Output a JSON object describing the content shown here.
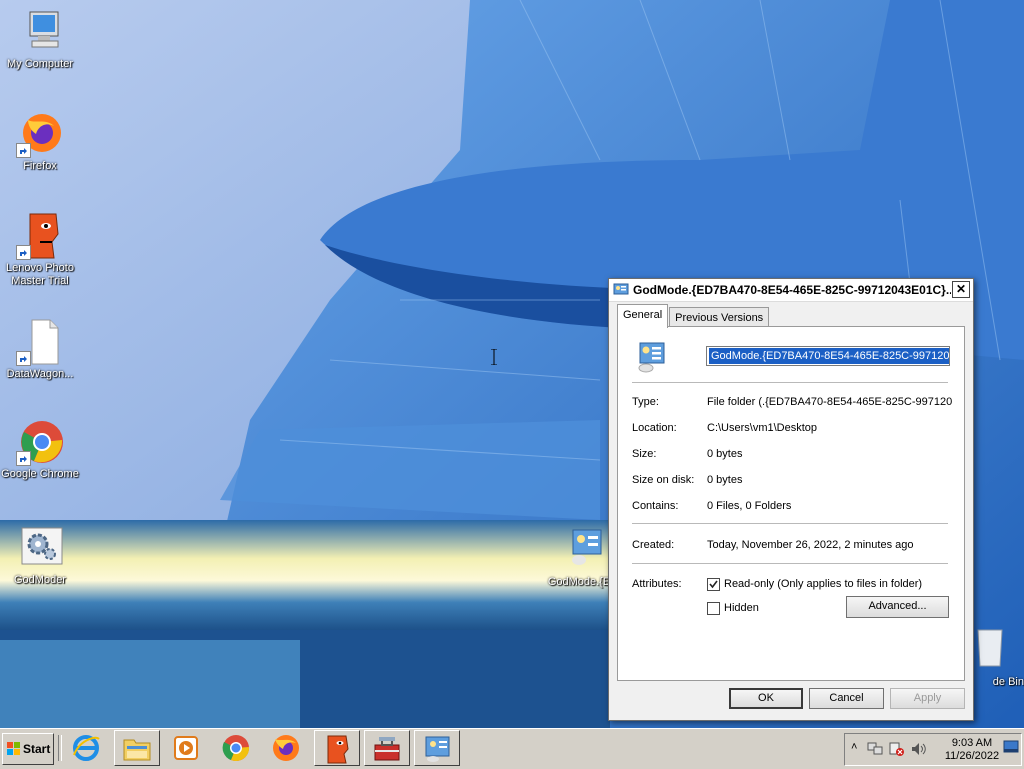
{
  "desktop": {
    "icons": [
      {
        "label": "My Computer"
      },
      {
        "label": "Firefox"
      },
      {
        "label": "Lenovo Photo Master Trial"
      },
      {
        "label": "DataWagon..."
      },
      {
        "label": "Google Chrome"
      },
      {
        "label": "GodModer"
      },
      {
        "label": "GodMode.{E"
      },
      {
        "label": "de Bin"
      }
    ]
  },
  "dialog": {
    "title": "GodMode.{ED7BA470-8E54-465E-825C-99712043E01C}...",
    "close_label": "✕",
    "tabs": [
      {
        "label": "General",
        "active": true
      },
      {
        "label": "Previous Versions",
        "active": false
      }
    ],
    "name_value": "GodMode.{ED7BA470-8E54-465E-825C-9971204",
    "fields": {
      "type": {
        "label": "Type:",
        "value": "File folder (.{ED7BA470-8E54-465E-825C-9971204"
      },
      "location": {
        "label": "Location:",
        "value": "C:\\Users\\vm1\\Desktop"
      },
      "size": {
        "label": "Size:",
        "value": "0 bytes"
      },
      "size_on_disk": {
        "label": "Size on disk:",
        "value": "0 bytes"
      },
      "contains": {
        "label": "Contains:",
        "value": "0 Files, 0 Folders"
      },
      "created": {
        "label": "Created:",
        "value": "Today, November 26, 2022, 2 minutes ago"
      }
    },
    "attributes": {
      "label": "Attributes:",
      "readonly_label": "Read-only (Only applies to files in folder)",
      "readonly_checked": true,
      "hidden_label": "Hidden",
      "hidden_checked": false,
      "advanced_label": "Advanced..."
    },
    "buttons": {
      "ok": "OK",
      "cancel": "Cancel",
      "apply": "Apply"
    }
  },
  "taskbar": {
    "start_label": "Start",
    "items": [
      "internet-explorer",
      "file-explorer",
      "media-player",
      "google-chrome",
      "firefox",
      "lenovo-photo-master",
      "toolbox",
      "godmode-folder"
    ],
    "clock_time": "9:03 AM",
    "clock_date": "11/26/2022"
  },
  "colors": {
    "selection": "#1b5fc5",
    "taskbar": "#d4d0c8",
    "dialog_bg": "#f0f0f0"
  }
}
